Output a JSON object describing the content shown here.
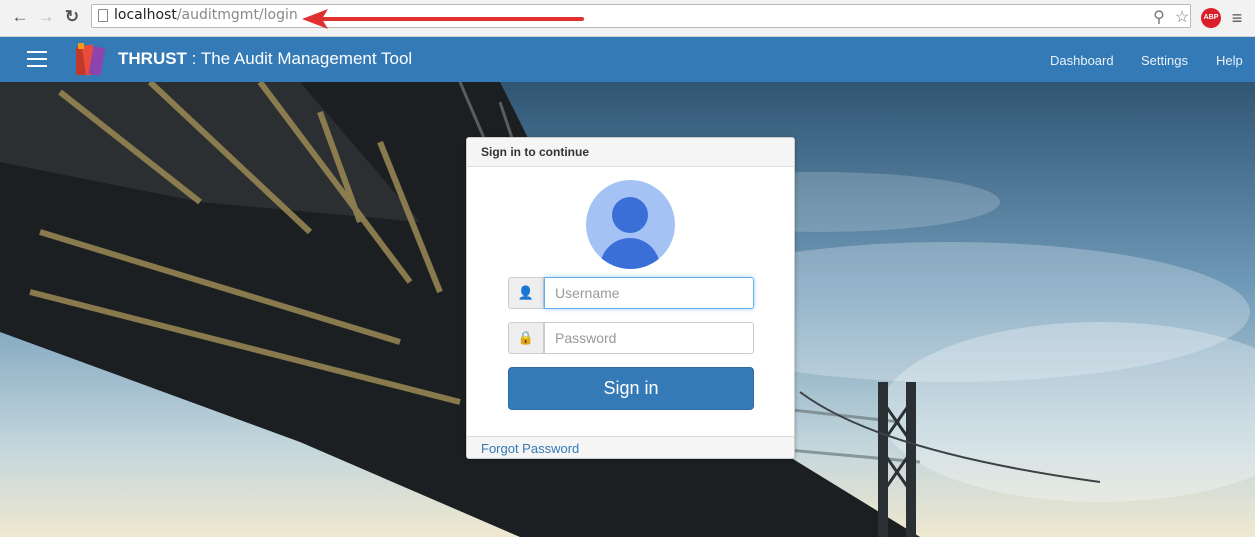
{
  "browser": {
    "url_host": "localhost",
    "url_path": "/auditmgmt/login",
    "abp_label": "ABP"
  },
  "navbar": {
    "brand_strong": "THRUST",
    "brand_rest": " : The Audit Management Tool",
    "links": [
      "Dashboard",
      "Settings",
      "Help"
    ],
    "bg_color": "#337ab7"
  },
  "login": {
    "title": "Sign in to continue",
    "username_placeholder": "Username",
    "password_placeholder": "Password",
    "signin_label": "Sign in",
    "forgot_label": "Forgot Password"
  }
}
